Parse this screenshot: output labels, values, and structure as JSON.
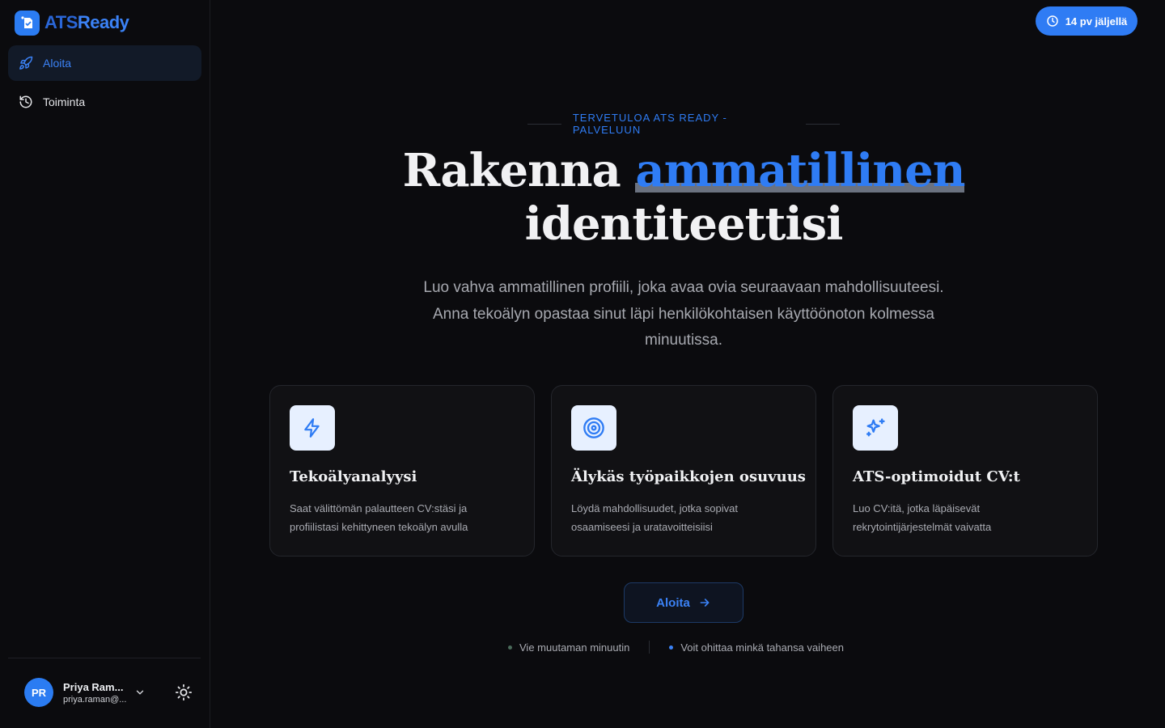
{
  "brand": {
    "name_part1": "ATS",
    "name_part2": "Ready"
  },
  "sidebar": {
    "items": [
      {
        "label": "Aloita",
        "icon": "rocket-icon",
        "active": true
      },
      {
        "label": "Toiminta",
        "icon": "history-icon",
        "active": false
      }
    ],
    "user": {
      "initials": "PR",
      "name": "Priya Ram...",
      "email": "priya.raman@..."
    }
  },
  "trial": {
    "label": "14 pv jäljellä",
    "icon": "clock-icon"
  },
  "hero": {
    "eyebrow": "TERVETULOA ATS READY -PALVELUUN",
    "title_part1": "Rakenna ",
    "title_highlight": "ammatillinen",
    "title_part2": "identiteettisi",
    "subtitle": "Luo vahva ammatillinen profiili, joka avaa ovia seuraavaan mahdollisuuteesi. Anna tekoälyn opastaa sinut läpi henkilökohtaisen käyttöönoton kolmessa minuutissa."
  },
  "features": [
    {
      "icon": "lightning-icon",
      "title": "Tekoälyanalyysi",
      "description": "Saat välittömän palautteen CV:stäsi ja profiilistasi kehittyneen tekoälyn avulla"
    },
    {
      "icon": "target-icon",
      "title": "Älykäs työpaikkojen osuvuus",
      "description": "Löydä mahdollisuudet, jotka sopivat osaamiseesi ja uratavoitteisiisi"
    },
    {
      "icon": "sparkles-icon",
      "title": "ATS-optimoidut CV:t",
      "description": "Luo CV:itä, jotka läpäisevät rekrytointijärjestelmät vaivatta"
    }
  ],
  "cta": {
    "label": "Aloita"
  },
  "notes": [
    {
      "text": "Vie muutaman minuutin",
      "dot_color": "#4a6b5a"
    },
    {
      "text": "Voit ohittaa minkä tahansa vaiheen",
      "dot_color": "#3b82f6"
    }
  ],
  "colors": {
    "accent": "#2f7cf4",
    "background": "#0b0b0e",
    "card": "#111114"
  }
}
